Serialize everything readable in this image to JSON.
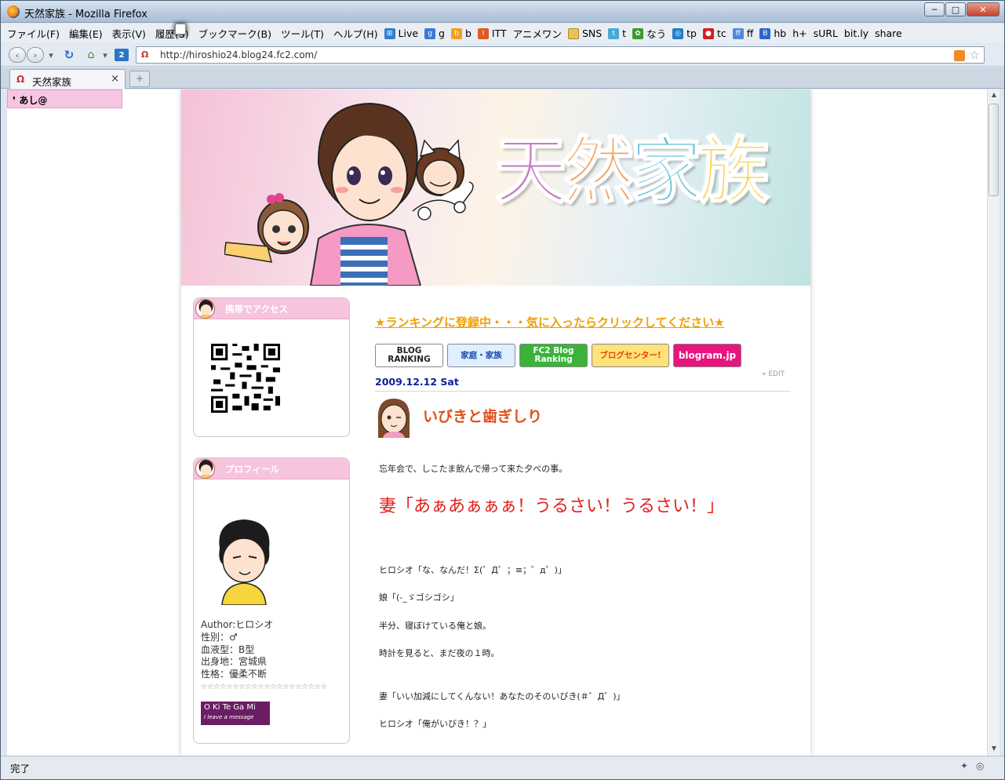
{
  "window": {
    "title": "天然家族 - Mozilla Firefox",
    "controls": {
      "minimize": "─",
      "maximize": "□",
      "close": "✕"
    }
  },
  "menubar": {
    "items": [
      "ファイル(F)",
      "編集(E)",
      "表示(V)",
      "履歴(S)",
      "ブックマーク(B)",
      "ツール(T)",
      "ヘルプ(H)"
    ]
  },
  "bookmarks": [
    {
      "label": "Live",
      "icon": "windows-icon",
      "color": "#2f7fd1",
      "glyph": "⊞"
    },
    {
      "label": "g",
      "icon": "google-icon",
      "color": "#3a7bd5",
      "glyph": "g"
    },
    {
      "label": "b",
      "icon": "b-icon",
      "color": "#f0a020",
      "glyph": "b"
    },
    {
      "label": "ITT",
      "icon": "itt-icon",
      "color": "#e15a1f",
      "glyph": "I"
    },
    {
      "label": "アニメワン",
      "icon": "page-icon",
      "color": "",
      "glyph": ""
    },
    {
      "label": "SNS",
      "icon": "folder-icon",
      "color": "#e8c35a",
      "glyph": ""
    },
    {
      "label": "t",
      "icon": "twitter-icon",
      "color": "#48a8d8",
      "glyph": "t"
    },
    {
      "label": "なう",
      "icon": "leaf-icon",
      "color": "#3c9a2a",
      "glyph": "✿"
    },
    {
      "label": "tp",
      "icon": "tp-icon",
      "color": "#1e7ec8",
      "glyph": "◎"
    },
    {
      "label": "tc",
      "icon": "tc-icon",
      "color": "#d21f1f",
      "glyph": "●"
    },
    {
      "label": "ff",
      "icon": "friendfeed-icon",
      "color": "#4f8ad6",
      "glyph": "ff"
    },
    {
      "label": "hb",
      "icon": "hatena-icon",
      "color": "#2b66c8",
      "glyph": "B"
    },
    {
      "label": "h+",
      "icon": "page-icon",
      "color": "",
      "glyph": ""
    },
    {
      "label": "sURL",
      "icon": "page-icon",
      "color": "",
      "glyph": ""
    },
    {
      "label": "bit.ly",
      "icon": "page-icon",
      "color": "",
      "glyph": ""
    },
    {
      "label": "share",
      "icon": "page-icon",
      "color": "",
      "glyph": ""
    }
  ],
  "navbar": {
    "url": "http://hiroshio24.blog24.fc2.com/",
    "back_glyph": "‹",
    "forward_glyph": "›",
    "reload_glyph": "↻",
    "home_glyph": "⌂",
    "num_glyph": "2"
  },
  "tab": {
    "label": "天然家族",
    "close": "×",
    "new_tab": "+"
  },
  "status": {
    "text": "完了"
  },
  "page": {
    "ashi_label": "あし@",
    "logo": [
      {
        "char": "天",
        "color": "#c77dc4"
      },
      {
        "char": "然",
        "color": "#f2a05e"
      },
      {
        "char": "家",
        "color": "#6cc3dd"
      },
      {
        "char": "族",
        "color": "#f7d24a"
      }
    ],
    "widgets": {
      "mobile": {
        "title": "携帯でアクセス"
      },
      "profile": {
        "title": "プロフィール",
        "lines": [
          "Author:ヒロシオ",
          "性別：♂",
          "血液型：B型",
          "出身地：宮城県",
          "性格：優柔不断",
          "☆☆☆☆☆☆☆☆☆☆☆☆☆☆☆☆☆☆☆☆"
        ],
        "okitegami_main": "O Ki Te Ga Mi",
        "okitegami_sub": "I leave a message"
      }
    },
    "ranking_text": "★ランキングに登録中・・・気に入ったらクリックしてください★",
    "banners": [
      {
        "label": "BLOG RANKING",
        "bg": "#ffffff",
        "fg": "#222222"
      },
      {
        "label": "家庭・家族",
        "bg": "#dfefff",
        "fg": "#1b4aa8"
      },
      {
        "label": "FC2 Blog Ranking",
        "bg": "#3bb33b",
        "fg": "#ffffff"
      },
      {
        "label": "ブログセンター!",
        "bg": "#ffe27a",
        "fg": "#e04a00"
      },
      {
        "label": "blogram.jp",
        "bg": "#e7157d",
        "fg": "#ffffff"
      }
    ],
    "entry": {
      "date": "2009.12.12 Sat",
      "edit": "» EDIT",
      "title": "いびきと歯ぎしり",
      "paragraphs": [
        "忘年会で、しこたま飲んで帰って来た夕べの事。",
        "妻「あぁあぁぁぁ！うるさい！うるさい！」",
        "ヒロシオ「な、なんだ！Σ(゜Д゜；≡；゜д゜)」",
        "娘「(-_ゞゴシゴシ」",
        "半分、寝ぼけている俺と娘。",
        "時計を見ると、まだ夜の１時。",
        "妻「いい加減にしてくんない！あなたのそのいびき(＃゜Д゜)」",
        "ヒロシオ「俺がいびき！？」"
      ]
    }
  }
}
